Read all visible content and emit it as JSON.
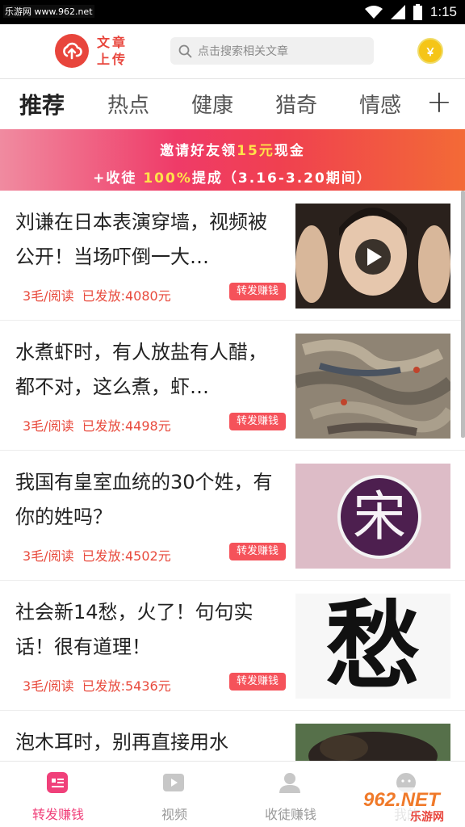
{
  "status_bar": {
    "watermark": "乐游网 www.962.net",
    "time": "1:15"
  },
  "header": {
    "logo_text": "文章上传",
    "search_placeholder": "点击搜索相关文章",
    "coin_symbol": "￥"
  },
  "tabs": [
    {
      "label": "推荐",
      "active": true
    },
    {
      "label": "热点"
    },
    {
      "label": "健康"
    },
    {
      "label": "猎奇"
    },
    {
      "label": "情感"
    }
  ],
  "tab_add": "+",
  "banner": {
    "line1_pre": "邀请好友领",
    "line1_amount": "15元",
    "line1_post": "现金",
    "line2_pre": "+收徒 ",
    "line2_pct": "100%",
    "line2_post": "提成（3.16-3.20期间）"
  },
  "feed": [
    {
      "title": "刘谦在日本表演穿墙，视频被公开！当场吓倒一大…",
      "rate": "3毛/阅读",
      "paid": "已发放:4080元",
      "action": "转发赚钱"
    },
    {
      "title": "水煮虾时，有人放盐有人醋，都不对，这么煮，虾…",
      "rate": "3毛/阅读",
      "paid": "已发放:4498元",
      "action": "转发赚钱"
    },
    {
      "title": "我国有皇室血统的30个姓，有你的姓吗？",
      "rate": "3毛/阅读",
      "paid": "已发放:4502元",
      "action": "转发赚钱",
      "thumb_char": "宋"
    },
    {
      "title": "社会新14愁，火了！句句实话！很有道理！",
      "rate": "3毛/阅读",
      "paid": "已发放:5436元",
      "action": "转发赚钱",
      "thumb_char": "愁"
    },
    {
      "title": "泡木耳时，别再直接用水"
    }
  ],
  "bottom_nav": [
    {
      "label": "转发赚钱",
      "active": true
    },
    {
      "label": "视频"
    },
    {
      "label": "收徒赚钱"
    },
    {
      "label": "我的"
    }
  ],
  "watermark_962": {
    "brand": "962.NET",
    "sub": "乐游网"
  },
  "colors": {
    "accent": "#f0407a",
    "red": "#e84a3c",
    "logo": "#e8453c",
    "coin": "#f5c518"
  }
}
